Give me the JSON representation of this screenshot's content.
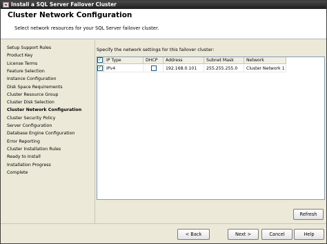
{
  "window": {
    "title": "Install a SQL Server Failover Cluster"
  },
  "header": {
    "title": "Cluster Network Configuration",
    "subtitle": "Select network resources for your SQL Server failover cluster."
  },
  "nav": {
    "items": [
      "Setup Support Rules",
      "Product Key",
      "License Terms",
      "Feature Selection",
      "Instance Configuration",
      "Disk Space Requirements",
      "Cluster Resource Group",
      "Cluster Disk Selection",
      "Cluster Network Configuration",
      "Cluster Security Policy",
      "Server Configuration",
      "Database Engine Configuration",
      "Error Reporting",
      "Cluster Installation Rules",
      "Ready to Install",
      "Installation Progress",
      "Complete"
    ],
    "current_index": 8
  },
  "content": {
    "instruction": "Specify the network settings for this failover cluster:",
    "grid": {
      "headers": [
        "IP Type",
        "DHCP",
        "Address",
        "Subnet Mask",
        "Network"
      ],
      "header_checked": true,
      "rows": [
        {
          "checked": true,
          "ip_type": "IPv4",
          "dhcp": false,
          "address": "192.168.0.101",
          "subnet_mask": "255.255.255.0",
          "network": "Cluster Network 1"
        }
      ]
    },
    "refresh_label": "Refresh"
  },
  "footer": {
    "back_label": "< Back",
    "next_label": "Next >",
    "cancel_label": "Cancel",
    "help_label": "Help"
  }
}
